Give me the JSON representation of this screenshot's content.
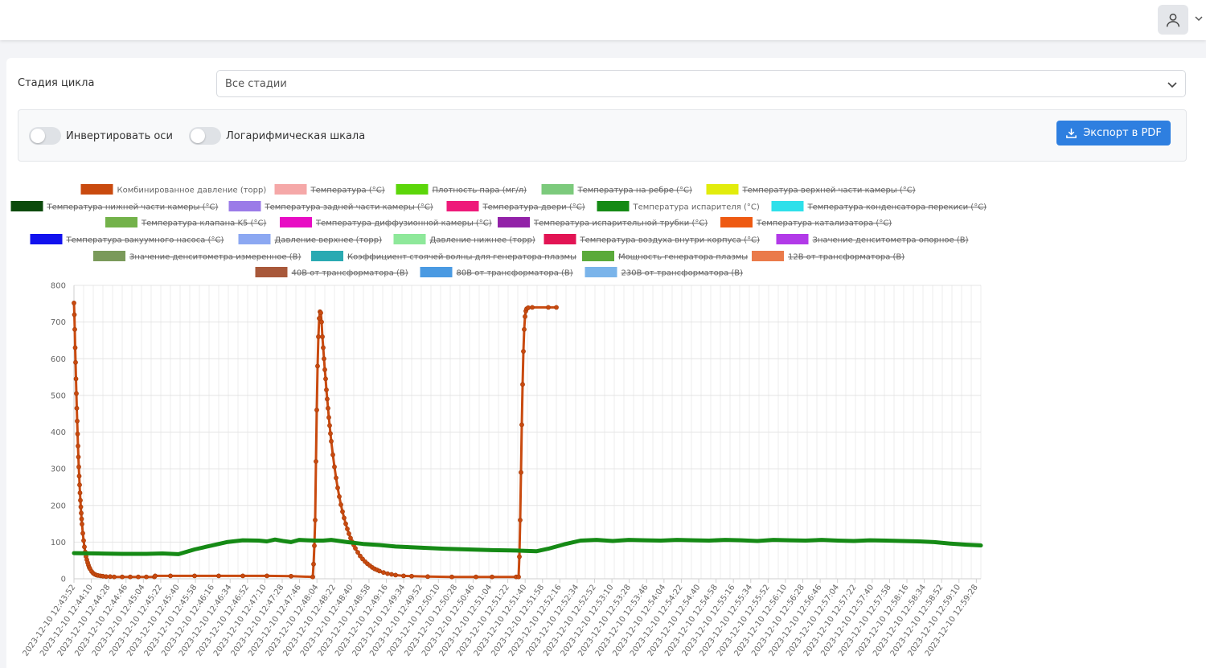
{
  "header": {
    "avatar_icon": "user-icon",
    "menu_icon": "chevron-down-icon"
  },
  "filter": {
    "label": "Стадия цикла",
    "value": "Все стадии"
  },
  "controls": {
    "invert_axes_label": "Инвертировать оси",
    "invert_axes_on": false,
    "log_scale_label": "Логарифмическая шкала",
    "log_scale_on": false,
    "export_label": "Экспорт в PDF",
    "export_icon": "download-icon",
    "accent_color": "#2e7fe0"
  },
  "chart_data": {
    "type": "line",
    "ylim": [
      0,
      800
    ],
    "yticks": [
      0,
      100,
      200,
      300,
      400,
      500,
      600,
      700,
      800
    ],
    "xticks": [
      "2023-12-10 12:43:52",
      "2023-12-10 12:44:10",
      "2023-12-10 12:44:28",
      "2023-12-10 12:44:46",
      "2023-12-10 12:45:04",
      "2023-12-10 12:45:22",
      "2023-12-10 12:45:40",
      "2023-12-10 12:45:58",
      "2023-12-10 12:46:16",
      "2023-12-10 12:46:34",
      "2023-12-10 12:46:52",
      "2023-12-10 12:47:10",
      "2023-12-10 12:47:28",
      "2023-12-10 12:47:46",
      "2023-12-10 12:48:04",
      "2023-12-10 12:48:22",
      "2023-12-10 12:48:40",
      "2023-12-10 12:48:58",
      "2023-12-10 12:49:16",
      "2023-12-10 12:49:34",
      "2023-12-10 12:49:52",
      "2023-12-10 12:50:10",
      "2023-12-10 12:50:28",
      "2023-12-10 12:50:46",
      "2023-12-10 12:51:04",
      "2023-12-10 12:51:22",
      "2023-12-10 12:51:40",
      "2023-12-10 12:51:58",
      "2023-12-10 12:52:16",
      "2023-12-10 12:52:34",
      "2023-12-10 12:52:52",
      "2023-12-10 12:53:10",
      "2023-12-10 12:53:28",
      "2023-12-10 12:53:46",
      "2023-12-10 12:54:04",
      "2023-12-10 12:54:22",
      "2023-12-10 12:54:40",
      "2023-12-10 12:54:58",
      "2023-12-10 12:55:16",
      "2023-12-10 12:55:34",
      "2023-12-10 12:55:52",
      "2023-12-10 12:56:10",
      "2023-12-10 12:56:28",
      "2023-12-10 12:56:46",
      "2023-12-10 12:57:04",
      "2023-12-10 12:57:22",
      "2023-12-10 12:57:40",
      "2023-12-10 12:57:58",
      "2023-12-10 12:58:16",
      "2023-12-10 12:58:34",
      "2023-12-10 12:58:52",
      "2023-12-10 12:59:10",
      "2023-12-10 12:59:28"
    ],
    "grid": true,
    "legend_position": "top",
    "legend": [
      {
        "name": "Комбинированное давление (торр)",
        "color": "#c94a0f",
        "hidden": false
      },
      {
        "name": "Температура (°С)",
        "color": "#f5a8a8",
        "hidden": true
      },
      {
        "name": "Плотность пара (мг/л)",
        "color": "#5cd60a",
        "hidden": true
      },
      {
        "name": "Температура на ребре (°С)",
        "color": "#7cca7c",
        "hidden": true
      },
      {
        "name": "Температура верхней части камеры (°С)",
        "color": "#e2ec0c",
        "hidden": true
      },
      {
        "name": "Температура нижней части камеры (°С)",
        "color": "#0c4a0c",
        "hidden": true
      },
      {
        "name": "Температура задней части камеры (°С)",
        "color": "#9b7be8",
        "hidden": true
      },
      {
        "name": "Температура двери (°С)",
        "color": "#ee1a7a",
        "hidden": true
      },
      {
        "name": "Температура испарителя (°С)",
        "color": "#158a15",
        "hidden": false
      },
      {
        "name": "Температура конденсатора перекиси (°С)",
        "color": "#2ee0ea",
        "hidden": true
      },
      {
        "name": "Температура клапана K5 (°С)",
        "color": "#73b24a",
        "hidden": true
      },
      {
        "name": "Температура диффузионной камеры (°С)",
        "color": "#e80cc4",
        "hidden": true
      },
      {
        "name": "Температура испарительной трубки (°С)",
        "color": "#9222a8",
        "hidden": true
      },
      {
        "name": "Температура катализатора (°С)",
        "color": "#ee5a12",
        "hidden": true
      },
      {
        "name": "Температура вакуумного насоса (°С)",
        "color": "#1212ee",
        "hidden": true
      },
      {
        "name": "Давление верхнее (торр)",
        "color": "#8ca8f2",
        "hidden": true
      },
      {
        "name": "Давление нижнее (торр)",
        "color": "#8ee89a",
        "hidden": true
      },
      {
        "name": "Температура воздуха внутри корпуса (°С)",
        "color": "#e21454",
        "hidden": true
      },
      {
        "name": "Значение денситометра опорное (В)",
        "color": "#b23ae8",
        "hidden": true
      },
      {
        "name": "Значение денситометра измеренное (В)",
        "color": "#7a9a5a",
        "hidden": true
      },
      {
        "name": "Коэффициент стоячей волны для генератора плазмы",
        "color": "#2aaab2",
        "hidden": true
      },
      {
        "name": "Мощность генератора плазмы",
        "color": "#5aaa3a",
        "hidden": true
      },
      {
        "name": "12В от трансформатора (В)",
        "color": "#ea7a4a",
        "hidden": true
      },
      {
        "name": "40В от трансформатора (В)",
        "color": "#a8583a",
        "hidden": true
      },
      {
        "name": "80В от трансформатора (В)",
        "color": "#4a9ae2",
        "hidden": true
      },
      {
        "name": "230В от трансформатора (В)",
        "color": "#7ab4ea",
        "hidden": true
      }
    ],
    "series": [
      {
        "name": "Комбинированное давление (торр)",
        "color": "#c94a0f",
        "points": [
          [
            0,
            752
          ],
          [
            0.5,
            720
          ],
          [
            1,
            680
          ],
          [
            1.5,
            630
          ],
          [
            2,
            590
          ],
          [
            2.5,
            545
          ],
          [
            3,
            505
          ],
          [
            3.5,
            465
          ],
          [
            4,
            430
          ],
          [
            4.5,
            395
          ],
          [
            5,
            362
          ],
          [
            5.5,
            332
          ],
          [
            6,
            305
          ],
          [
            6.5,
            280
          ],
          [
            7,
            256
          ],
          [
            7.5,
            234
          ],
          [
            8,
            214
          ],
          [
            8.5,
            196
          ],
          [
            9,
            179
          ],
          [
            9.5,
            163
          ],
          [
            10,
            149
          ],
          [
            11,
            124
          ],
          [
            12,
            104
          ],
          [
            13,
            87
          ],
          [
            14,
            73
          ],
          [
            15,
            61
          ],
          [
            16,
            52
          ],
          [
            17,
            44
          ],
          [
            18,
            37
          ],
          [
            19,
            31
          ],
          [
            20,
            27
          ],
          [
            22,
            20
          ],
          [
            24,
            15
          ],
          [
            26,
            12
          ],
          [
            28,
            10
          ],
          [
            30,
            9
          ],
          [
            33,
            8
          ],
          [
            36,
            7
          ],
          [
            40,
            6
          ],
          [
            45,
            6
          ],
          [
            50,
            5
          ],
          [
            60,
            5
          ],
          [
            70,
            5
          ],
          [
            80,
            5
          ],
          [
            90,
            5
          ],
          [
            100,
            5
          ],
          [
            101,
            8
          ],
          [
            120,
            8
          ],
          [
            150,
            8
          ],
          [
            180,
            8
          ],
          [
            210,
            8
          ],
          [
            240,
            8
          ],
          [
            270,
            7
          ],
          [
            297,
            5
          ],
          [
            298,
            40
          ],
          [
            299,
            90
          ],
          [
            300,
            160
          ],
          [
            301,
            320
          ],
          [
            302,
            460
          ],
          [
            303,
            580
          ],
          [
            304,
            660
          ],
          [
            305,
            710
          ],
          [
            306,
            728
          ],
          [
            307,
            725
          ],
          [
            308,
            700
          ],
          [
            309,
            660
          ],
          [
            310,
            630
          ],
          [
            311,
            600
          ],
          [
            312,
            570
          ],
          [
            313,
            545
          ],
          [
            314,
            515
          ],
          [
            315,
            490
          ],
          [
            316,
            465
          ],
          [
            317,
            440
          ],
          [
            318,
            418
          ],
          [
            319,
            396
          ],
          [
            320,
            375
          ],
          [
            322,
            338
          ],
          [
            324,
            305
          ],
          [
            326,
            275
          ],
          [
            328,
            248
          ],
          [
            330,
            224
          ],
          [
            332,
            202
          ],
          [
            334,
            183
          ],
          [
            336,
            166
          ],
          [
            338,
            150
          ],
          [
            340,
            136
          ],
          [
            342,
            123
          ],
          [
            344,
            111
          ],
          [
            346,
            101
          ],
          [
            348,
            92
          ],
          [
            350,
            83
          ],
          [
            353,
            72
          ],
          [
            356,
            62
          ],
          [
            359,
            54
          ],
          [
            362,
            47
          ],
          [
            365,
            41
          ],
          [
            368,
            36
          ],
          [
            371,
            31
          ],
          [
            374,
            27
          ],
          [
            377,
            24
          ],
          [
            380,
            21
          ],
          [
            385,
            17
          ],
          [
            390,
            14
          ],
          [
            395,
            12
          ],
          [
            400,
            10
          ],
          [
            410,
            8
          ],
          [
            420,
            7
          ],
          [
            440,
            6
          ],
          [
            470,
            5
          ],
          [
            500,
            5
          ],
          [
            520,
            5
          ],
          [
            550,
            5
          ],
          [
            553,
            5
          ],
          [
            554,
            60
          ],
          [
            555,
            160
          ],
          [
            556,
            290
          ],
          [
            557,
            420
          ],
          [
            558,
            530
          ],
          [
            559,
            620
          ],
          [
            560,
            680
          ],
          [
            561,
            715
          ],
          [
            562,
            730
          ],
          [
            563,
            736
          ],
          [
            565,
            739
          ],
          [
            570,
            740
          ],
          [
            590,
            740
          ],
          [
            600,
            740
          ]
        ]
      },
      {
        "name": "Температура испарителя (°С)",
        "color": "#158a15",
        "points": [
          [
            0,
            70
          ],
          [
            30,
            69
          ],
          [
            60,
            68
          ],
          [
            90,
            68
          ],
          [
            110,
            69
          ],
          [
            130,
            67
          ],
          [
            150,
            80
          ],
          [
            170,
            90
          ],
          [
            190,
            100
          ],
          [
            210,
            105
          ],
          [
            230,
            104
          ],
          [
            240,
            102
          ],
          [
            250,
            107
          ],
          [
            260,
            103
          ],
          [
            270,
            100
          ],
          [
            280,
            106
          ],
          [
            290,
            105
          ],
          [
            300,
            104
          ],
          [
            310,
            104
          ],
          [
            320,
            106
          ],
          [
            340,
            100
          ],
          [
            360,
            95
          ],
          [
            380,
            92
          ],
          [
            400,
            88
          ],
          [
            430,
            85
          ],
          [
            460,
            82
          ],
          [
            490,
            80
          ],
          [
            520,
            78
          ],
          [
            550,
            77
          ],
          [
            575,
            75
          ],
          [
            590,
            82
          ],
          [
            610,
            94
          ],
          [
            630,
            104
          ],
          [
            650,
            106
          ],
          [
            670,
            103
          ],
          [
            690,
            106
          ],
          [
            710,
            105
          ],
          [
            730,
            104
          ],
          [
            750,
            106
          ],
          [
            770,
            105
          ],
          [
            790,
            104
          ],
          [
            810,
            106
          ],
          [
            830,
            105
          ],
          [
            850,
            103
          ],
          [
            870,
            106
          ],
          [
            890,
            105
          ],
          [
            910,
            104
          ],
          [
            930,
            106
          ],
          [
            950,
            104
          ],
          [
            970,
            103
          ],
          [
            990,
            105
          ],
          [
            1010,
            104
          ],
          [
            1030,
            103
          ],
          [
            1050,
            102
          ],
          [
            1070,
            100
          ],
          [
            1090,
            96
          ],
          [
            1110,
            93
          ],
          [
            1128,
            91
          ]
        ]
      }
    ]
  }
}
